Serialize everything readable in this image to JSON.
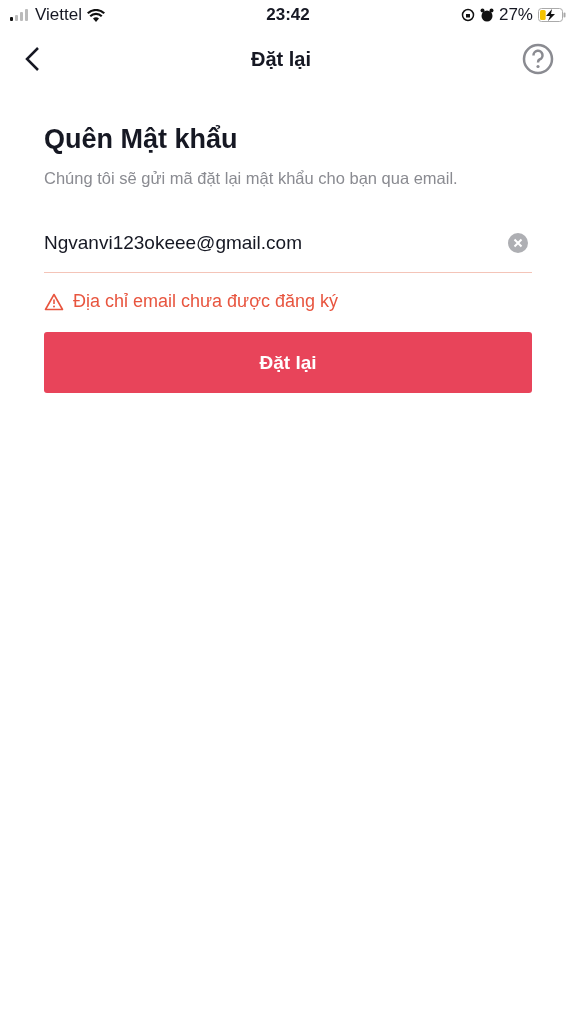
{
  "status_bar": {
    "carrier": "Viettel",
    "time": "23:42",
    "battery": "27%",
    "charging": true
  },
  "nav": {
    "title": "Đặt lại"
  },
  "heading": "Quên Mật khẩu",
  "description": "Chúng tôi sẽ gửi mã đặt lại mật khẩu cho bạn qua email.",
  "email_field": {
    "value": "Ngvanvi123okeee@gmail.com",
    "error": true
  },
  "error_message": "Địa chỉ email chưa được đăng ký",
  "submit_button": {
    "label": "Đặt lại"
  }
}
